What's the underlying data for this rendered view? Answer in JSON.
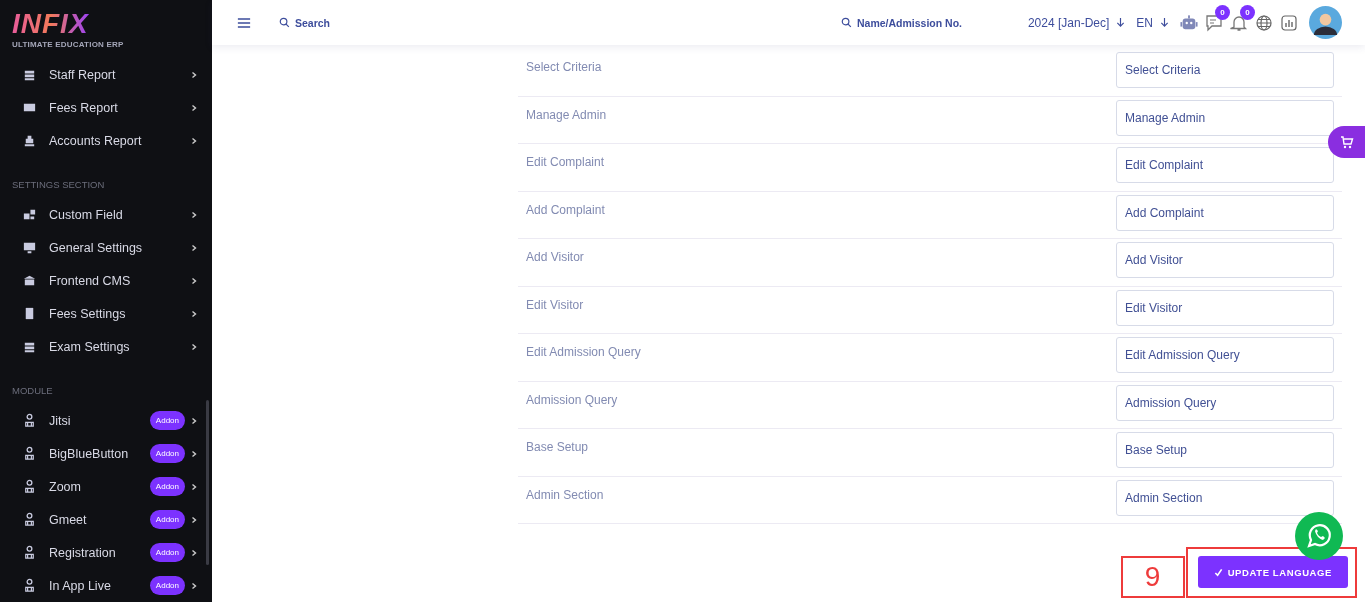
{
  "logo": {
    "name": "INFIX",
    "tagline": "ULTIMATE EDUCATION ERP"
  },
  "sidebar": {
    "groups": [
      {
        "items": [
          {
            "label": "Staff Report"
          },
          {
            "label": "Fees Report"
          },
          {
            "label": "Accounts Report"
          }
        ]
      },
      {
        "heading": "SETTINGS SECTION",
        "items": [
          {
            "label": "Custom Field"
          },
          {
            "label": "General Settings"
          },
          {
            "label": "Frontend CMS"
          },
          {
            "label": "Fees Settings"
          },
          {
            "label": "Exam Settings"
          }
        ]
      },
      {
        "heading": "MODULE",
        "items": [
          {
            "label": "Jitsi",
            "badge": "Addon"
          },
          {
            "label": "BigBlueButton",
            "badge": "Addon"
          },
          {
            "label": "Zoom",
            "badge": "Addon"
          },
          {
            "label": "Gmeet",
            "badge": "Addon"
          },
          {
            "label": "Registration",
            "badge": "Addon"
          },
          {
            "label": "In App Live",
            "badge": "Addon"
          }
        ]
      }
    ]
  },
  "header": {
    "search": {
      "placeholder": "Search"
    },
    "student_search": {
      "placeholder": "Name/Admission No."
    },
    "session": "2024 [Jan-Dec]",
    "language": "EN",
    "messages_count": "0",
    "notifications_count": "0"
  },
  "rows": [
    {
      "label": "Select Criteria",
      "value": "Select Criteria"
    },
    {
      "label": "Manage Admin",
      "value": "Manage Admin"
    },
    {
      "label": "Edit Complaint",
      "value": "Edit Complaint"
    },
    {
      "label": "Add Complaint",
      "value": "Add Complaint"
    },
    {
      "label": "Add Visitor",
      "value": "Add Visitor"
    },
    {
      "label": "Edit Visitor",
      "value": "Edit Visitor"
    },
    {
      "label": "Edit Admission Query",
      "value": "Edit Admission Query"
    },
    {
      "label": "Admission Query",
      "value": "Admission Query"
    },
    {
      "label": "Base Setup",
      "value": "Base Setup"
    },
    {
      "label": "Admin Section",
      "value": "Admin Section"
    }
  ],
  "submit_button": {
    "label": "UPDATE LANGUAGE"
  },
  "annotation": {
    "number": "9"
  }
}
